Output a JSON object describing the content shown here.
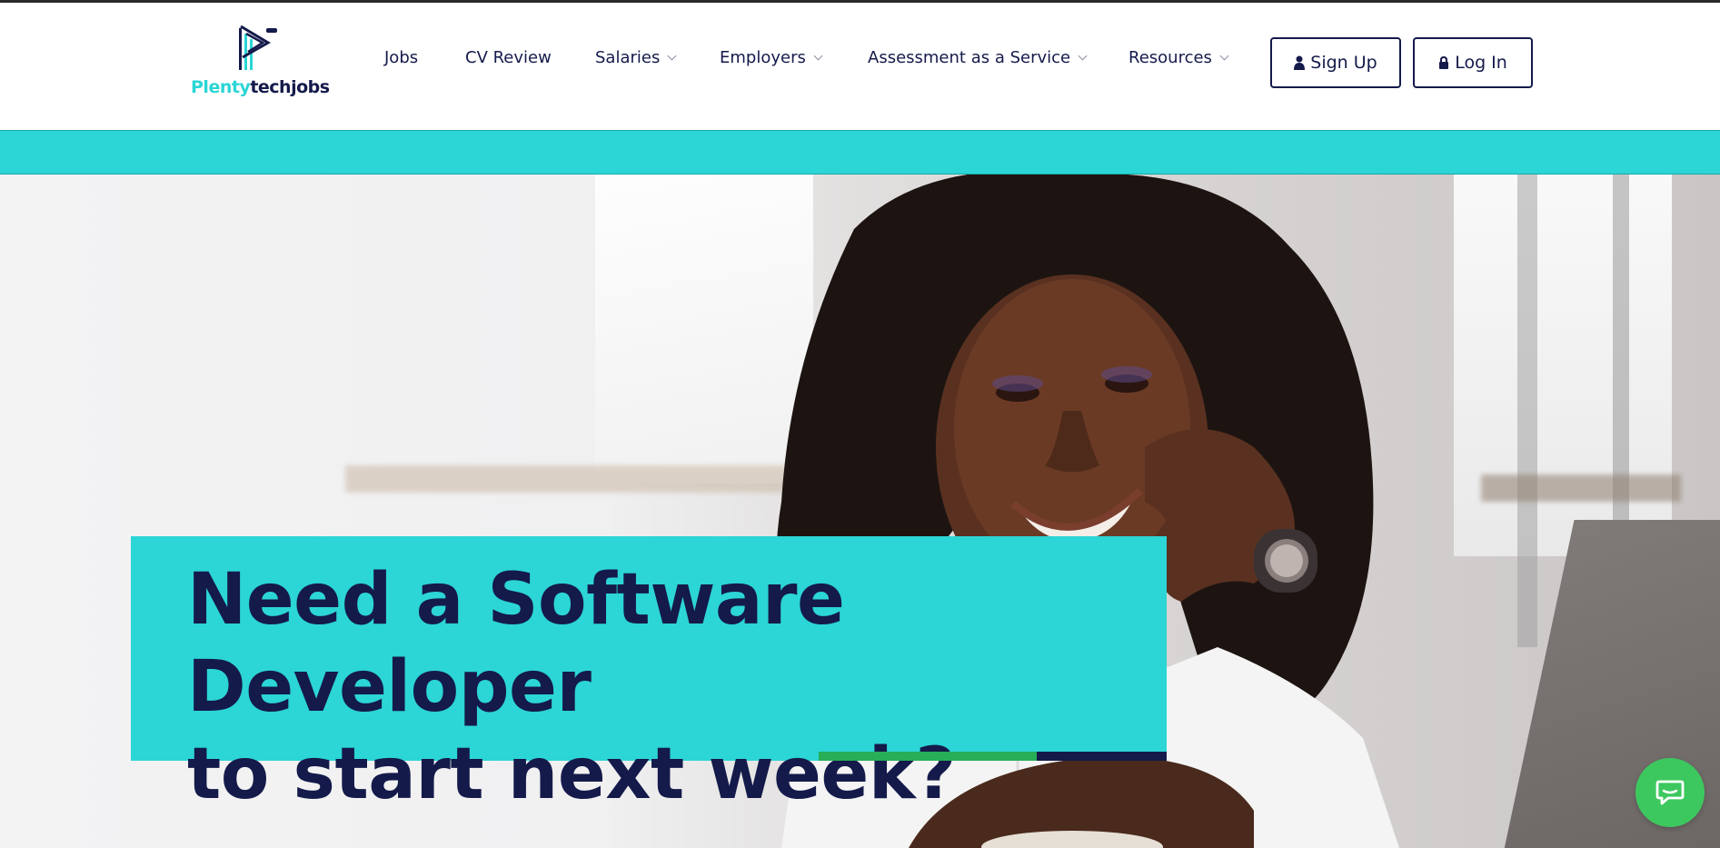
{
  "brand": {
    "name_part1": "Plenty",
    "name_part2": "techjobs",
    "accent_color": "#2cd5d6",
    "navy_color": "#141a4a",
    "green_color": "#27ae57"
  },
  "nav": {
    "items": [
      {
        "label": "Jobs",
        "has_dropdown": false
      },
      {
        "label": "CV Review",
        "has_dropdown": false
      },
      {
        "label": "Salaries",
        "has_dropdown": true
      },
      {
        "label": "Employers",
        "has_dropdown": true
      },
      {
        "label": "Assessment as a Service",
        "has_dropdown": true
      },
      {
        "label": "Resources",
        "has_dropdown": true
      }
    ],
    "signup_label": "Sign Up",
    "signup_icon": "user-icon",
    "login_label": "Log In",
    "login_icon": "lock-icon"
  },
  "hero": {
    "headline_line1": "Need a Software Developer",
    "headline_line2": "to start next week?",
    "image": "smiling woman resting chin on hand in cafe"
  },
  "chat": {
    "icon": "chat-bubble-icon",
    "color": "#3dc85f"
  }
}
